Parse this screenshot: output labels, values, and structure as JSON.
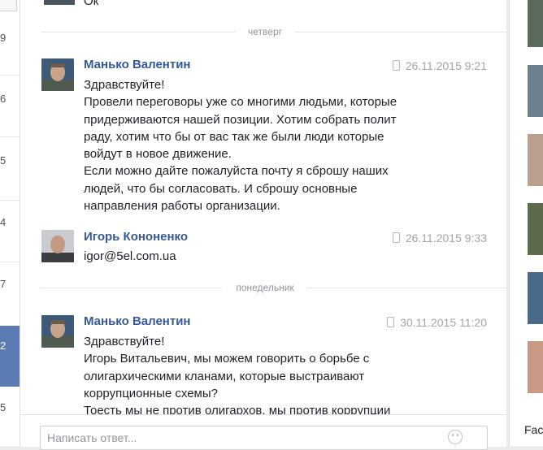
{
  "left_list": {
    "numbers": [
      "9",
      "6",
      "5",
      "4",
      "7",
      "2",
      "5"
    ]
  },
  "top_message": {
    "text": "Ок"
  },
  "separators": [
    "четверг",
    "понедельник"
  ],
  "messages": [
    {
      "sender": "Манько Валентин",
      "timestamp": "26.11.2015 9:21",
      "lines": [
        "Здравствуйте!",
        "Провели переговоры уже со многими людьми, которые",
        "придерживаются нашей позиции. Хотим собрать полит",
        "раду, хотим что бы от вас так же были люди которые",
        "войдут в новое движение.",
        "Если можно дайте пожалуйста почту я сброшу наших",
        "людей, что бы согласовать. И сброшу основные",
        "направления работы организации."
      ]
    },
    {
      "sender": "Игорь Кононенко",
      "timestamp": "26.11.2015 9:33",
      "lines": [
        "igor@5el.com.ua"
      ]
    },
    {
      "sender": "Манько Валентин",
      "timestamp": "30.11.2015 11:20",
      "lines": [
        "Здравствуйте!",
        "Игорь Витальевич, мы можем говорить о борьбе с",
        "олигархическими кланами, которые выстраивают",
        "коррупционные схемы?",
        "Тоесть мы не против олигархов, мы против коррупции"
      ]
    }
  ],
  "reply": {
    "placeholder": "Написать ответ..."
  },
  "right_col": {
    "footer_text": "Fac"
  },
  "colors": {
    "name_link": "#365899",
    "selected_item": "#5b7bb3"
  }
}
